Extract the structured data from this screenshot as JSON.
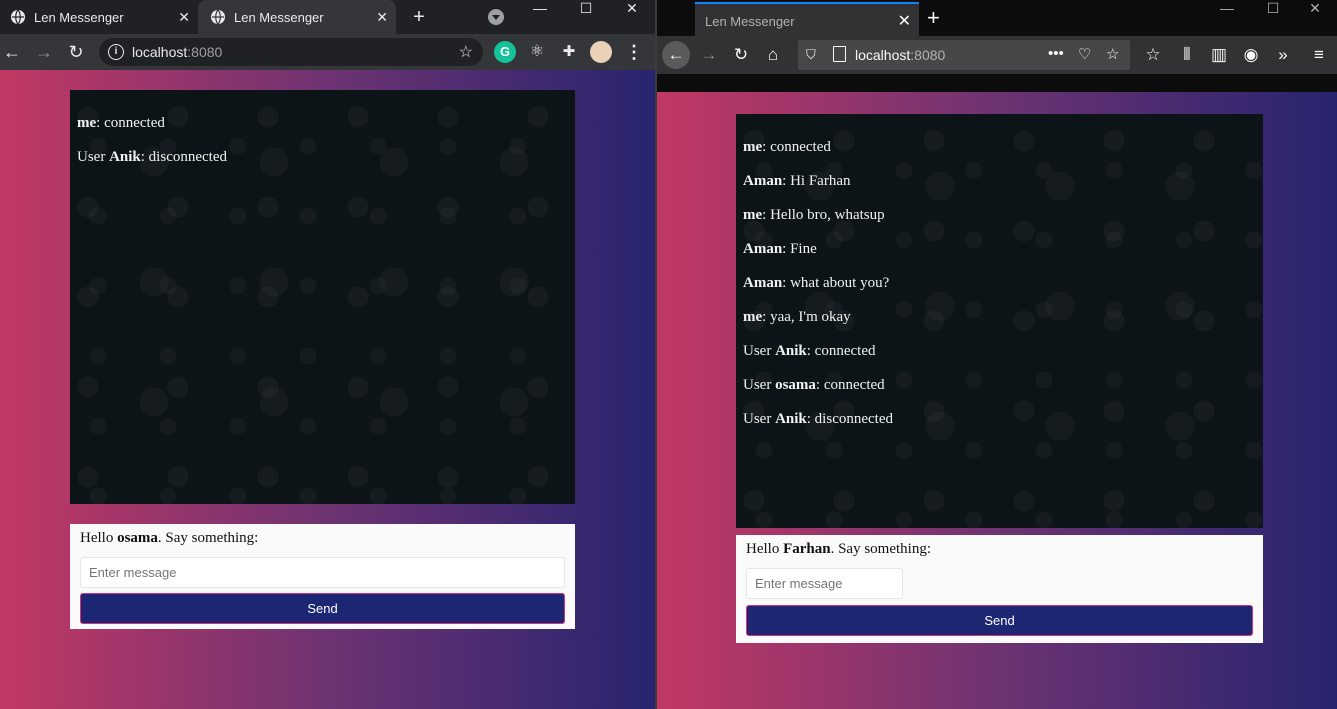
{
  "left_browser": {
    "tabs": [
      {
        "title": "Len Messenger",
        "active": false
      },
      {
        "title": "Len Messenger",
        "active": true
      }
    ],
    "new_tab": "+",
    "address": {
      "host": "localhost",
      "port": ":8080"
    },
    "window_controls": {
      "minimize": "—",
      "maximize": "☐",
      "close": "✕"
    },
    "chat": {
      "messages": [
        {
          "prefix": "",
          "name": "me",
          "text": ": connected"
        },
        {
          "prefix": "User ",
          "name": "Anik",
          "text": ": disconnected"
        }
      ],
      "greeting": {
        "hello": "Hello ",
        "name": "osama",
        "suffix": ". Say something:"
      },
      "input_placeholder": "Enter message",
      "send_label": "Send"
    }
  },
  "right_browser": {
    "tab_title": "Len Messenger",
    "new_tab": "+",
    "address": {
      "host": "localhost",
      "port": ":8080"
    },
    "window_controls": {
      "minimize": "—",
      "maximize": "☐",
      "close": "✕"
    },
    "chat": {
      "messages": [
        {
          "prefix": "",
          "name": "me",
          "text": ": connected"
        },
        {
          "prefix": "",
          "name": "Aman",
          "text": ": Hi Farhan"
        },
        {
          "prefix": "",
          "name": "me",
          "text": ": Hello bro, whatsup"
        },
        {
          "prefix": "",
          "name": "Aman",
          "text": ": Fine"
        },
        {
          "prefix": "",
          "name": "Aman",
          "text": ": what about you?"
        },
        {
          "prefix": "",
          "name": "me",
          "text": ": yaa, I'm okay"
        },
        {
          "prefix": "User ",
          "name": "Anik",
          "text": ": connected"
        },
        {
          "prefix": "User ",
          "name": "osama",
          "text": ": connected"
        },
        {
          "prefix": "User ",
          "name": "Anik",
          "text": ": disconnected"
        }
      ],
      "greeting": {
        "hello": "Hello ",
        "name": "Farhan",
        "suffix": ". Say something:"
      },
      "input_placeholder": "Enter message",
      "send_label": "Send"
    }
  },
  "colors": {
    "chat_bg": "#0d1418",
    "send_bg": "#1c2672",
    "send_border": "#d8307a",
    "gradient_start": "#c23864",
    "gradient_end": "#27246f"
  }
}
